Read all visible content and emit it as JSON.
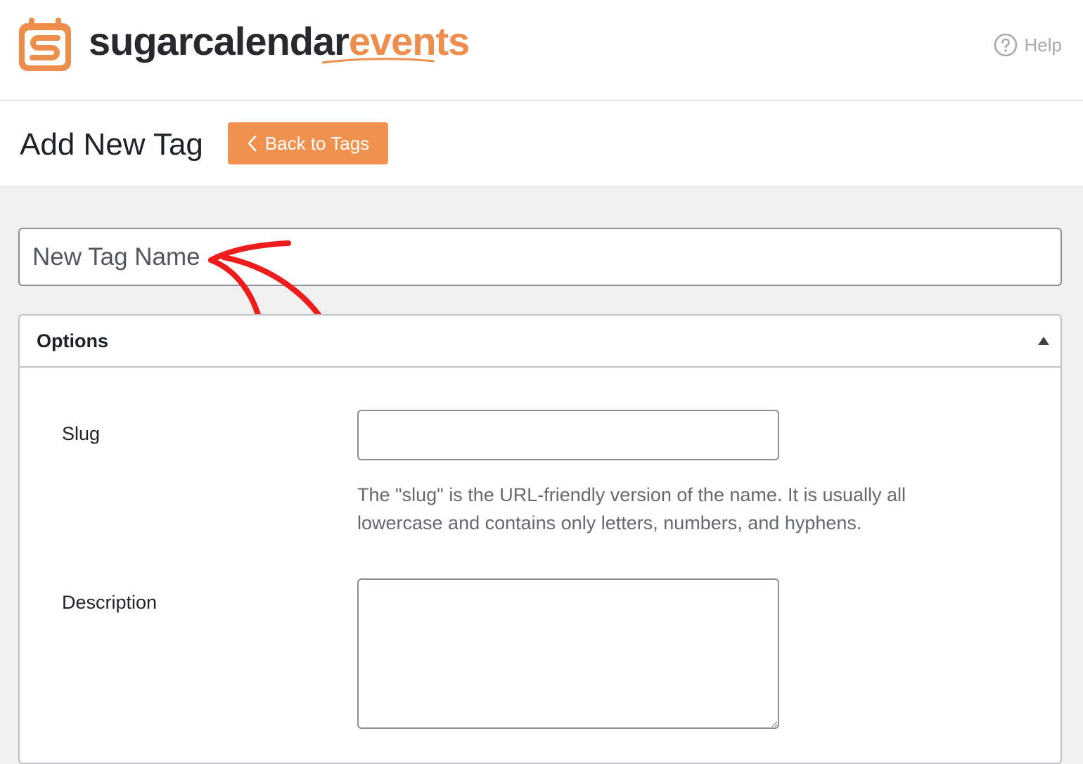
{
  "brand": {
    "name_primary": "sugarcalendar",
    "name_accent": "events",
    "logo_icon": "calendar-s-logo",
    "accent_color": "#ee8e4d"
  },
  "header": {
    "help_label": "Help",
    "help_icon": "question-circle-icon"
  },
  "page": {
    "title": "Add New Tag",
    "back_button_label": "Back to Tags",
    "back_icon": "chevron-left-icon"
  },
  "form": {
    "name_placeholder": "New Tag Name",
    "name_value": "",
    "annotation": "red-arrow-annotation",
    "options": {
      "title": "Options",
      "toggle_icon": "triangle-up-icon",
      "slug": {
        "label": "Slug",
        "value": "",
        "help": "The \"slug\" is the URL-friendly version of the name. It is usually all lowercase and contains only letters, numbers, and hyphens."
      },
      "description": {
        "label": "Description",
        "value": ""
      }
    }
  }
}
